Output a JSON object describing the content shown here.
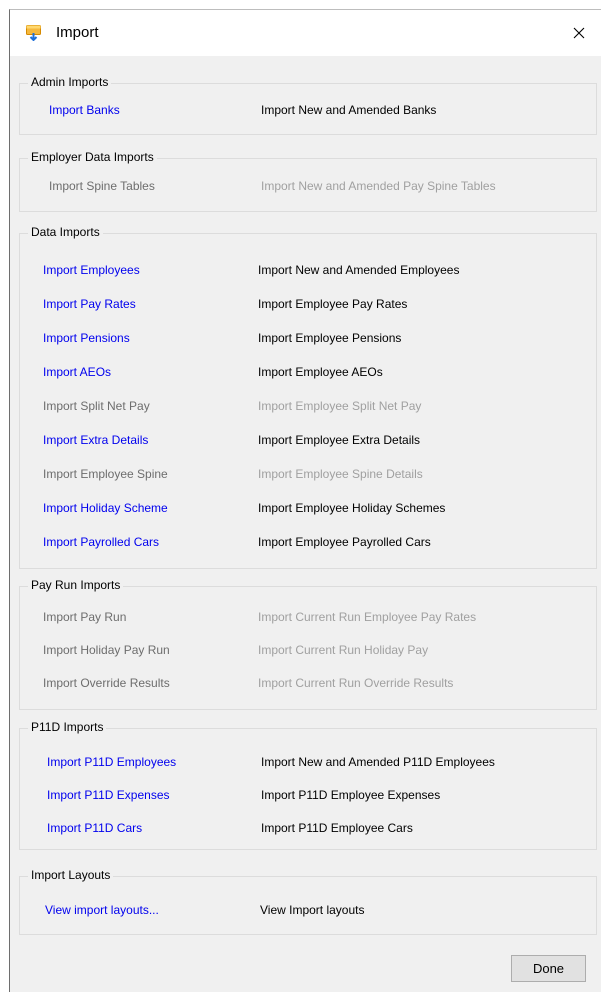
{
  "window": {
    "title": "Import"
  },
  "groups": [
    {
      "title": "Admin Imports",
      "items": [
        {
          "label": "Import Banks",
          "desc": "Import New and Amended Banks",
          "enabled": true
        }
      ]
    },
    {
      "title": "Employer Data Imports",
      "items": [
        {
          "label": "Import Spine Tables",
          "desc": "Import New and Amended Pay Spine Tables",
          "enabled": false
        }
      ]
    },
    {
      "title": "Data Imports",
      "items": [
        {
          "label": "Import Employees",
          "desc": "Import New and Amended Employees",
          "enabled": true
        },
        {
          "label": "Import Pay Rates",
          "desc": "Import Employee Pay Rates",
          "enabled": true
        },
        {
          "label": "Import Pensions",
          "desc": "Import Employee Pensions",
          "enabled": true
        },
        {
          "label": "Import AEOs",
          "desc": "Import Employee AEOs",
          "enabled": true
        },
        {
          "label": "Import Split Net Pay",
          "desc": "Import Employee Split Net Pay",
          "enabled": false
        },
        {
          "label": "Import Extra Details",
          "desc": "Import Employee Extra Details",
          "enabled": true
        },
        {
          "label": "Import Employee Spine",
          "desc": "Import Employee Spine Details",
          "enabled": false
        },
        {
          "label": "Import Holiday Scheme",
          "desc": "Import Employee Holiday Schemes",
          "enabled": true
        },
        {
          "label": "Import Payrolled Cars",
          "desc": "Import Employee Payrolled Cars",
          "enabled": true
        }
      ]
    },
    {
      "title": "Pay Run Imports",
      "items": [
        {
          "label": "Import Pay Run",
          "desc": "Import Current Run Employee Pay Rates",
          "enabled": false
        },
        {
          "label": "Import Holiday Pay Run",
          "desc": "Import Current Run Holiday Pay",
          "enabled": false
        },
        {
          "label": "Import Override Results",
          "desc": "Import Current Run Override Results",
          "enabled": false
        }
      ]
    },
    {
      "title": "P11D Imports",
      "items": [
        {
          "label": "Import P11D Employees",
          "desc": "Import New and Amended P11D Employees",
          "enabled": true
        },
        {
          "label": "Import P11D Expenses",
          "desc": "Import P11D Employee Expenses",
          "enabled": true
        },
        {
          "label": "Import P11D Cars",
          "desc": "Import P11D Employee Cars",
          "enabled": true
        }
      ]
    },
    {
      "title": "Import Layouts",
      "items": [
        {
          "label": "View import layouts...",
          "desc": "View Import layouts",
          "enabled": true
        }
      ]
    }
  ],
  "footer": {
    "done_label": "Done"
  },
  "colors": {
    "link": "#0000ee",
    "disabled_link": "#6d6d6d",
    "disabled_text": "#a0a0a0",
    "dialog_bg": "#f0f0f0"
  },
  "icons": {
    "app": "import-app-icon",
    "close": "close-icon"
  }
}
